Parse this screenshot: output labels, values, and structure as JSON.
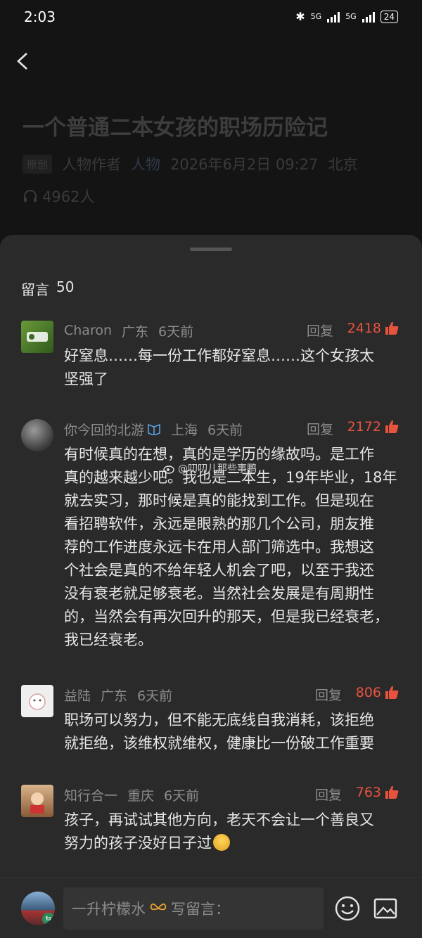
{
  "status": {
    "time": "2:03",
    "net1": "5G",
    "net2": "5G",
    "battery": "24"
  },
  "article": {
    "title": "一个普通二本女孩的职场历险记",
    "badge": "原创",
    "author": "人物作者",
    "channel": "人物",
    "date": "2026年6月2日 09:27",
    "location": "北京",
    "listeners": "4962人"
  },
  "comments_header": {
    "label": "留言",
    "count": "50"
  },
  "comments": [
    {
      "name": "Charon",
      "region": "广东",
      "time": "6天前",
      "reply": "回复",
      "likes": "2418",
      "lines": [
        "好窒息……每一份工作都好窒息……这个女孩太",
        "坚强了"
      ]
    },
    {
      "name": "你今回的北游",
      "region": "上海",
      "time": "6天前",
      "reply": "回复",
      "likes": "2172",
      "lines": [
        "有时候真的在想，真的是学历的缘故吗。是工作",
        "真的越来越少吧。我也是二本生，19年毕业，18年",
        "就去实习，那时候是真的能找到工作。但是现在",
        "看招聘软件，永远是眼熟的那几个公司，朋友推",
        "荐的工作进度永远卡在用人部门筛选中。我想这",
        "个社会是真的不给年轻人机会了吧，以至于我还",
        "没有衰老就足够衰老。当然社会发展是有周期性",
        "的，当然会有再次回升的那天，但是我已经衰老，",
        "我已经衰老。"
      ]
    },
    {
      "name": "益陆",
      "region": "广东",
      "time": "6天前",
      "reply": "回复",
      "likes": "806",
      "lines": [
        "职场可以努力，但不能无底线自我消耗，该拒绝",
        "就拒绝，该维权就维权，健康比一份破工作重要"
      ]
    },
    {
      "name": "知行合一",
      "region": "重庆",
      "time": "6天前",
      "reply": "回复",
      "likes": "763",
      "lines": [
        "孩子，再试试其他方向，老天不会让一个善良又",
        "努力的孩子没好日子过"
      ]
    }
  ],
  "watermark": "@叨叨儿那些事鹏",
  "input": {
    "placeholder_name": "一升柠檬水",
    "placeholder_action": "写留言："
  },
  "colors": {
    "like": "#e8533e",
    "sheet": "#2a2a2a",
    "background": "#141414"
  }
}
